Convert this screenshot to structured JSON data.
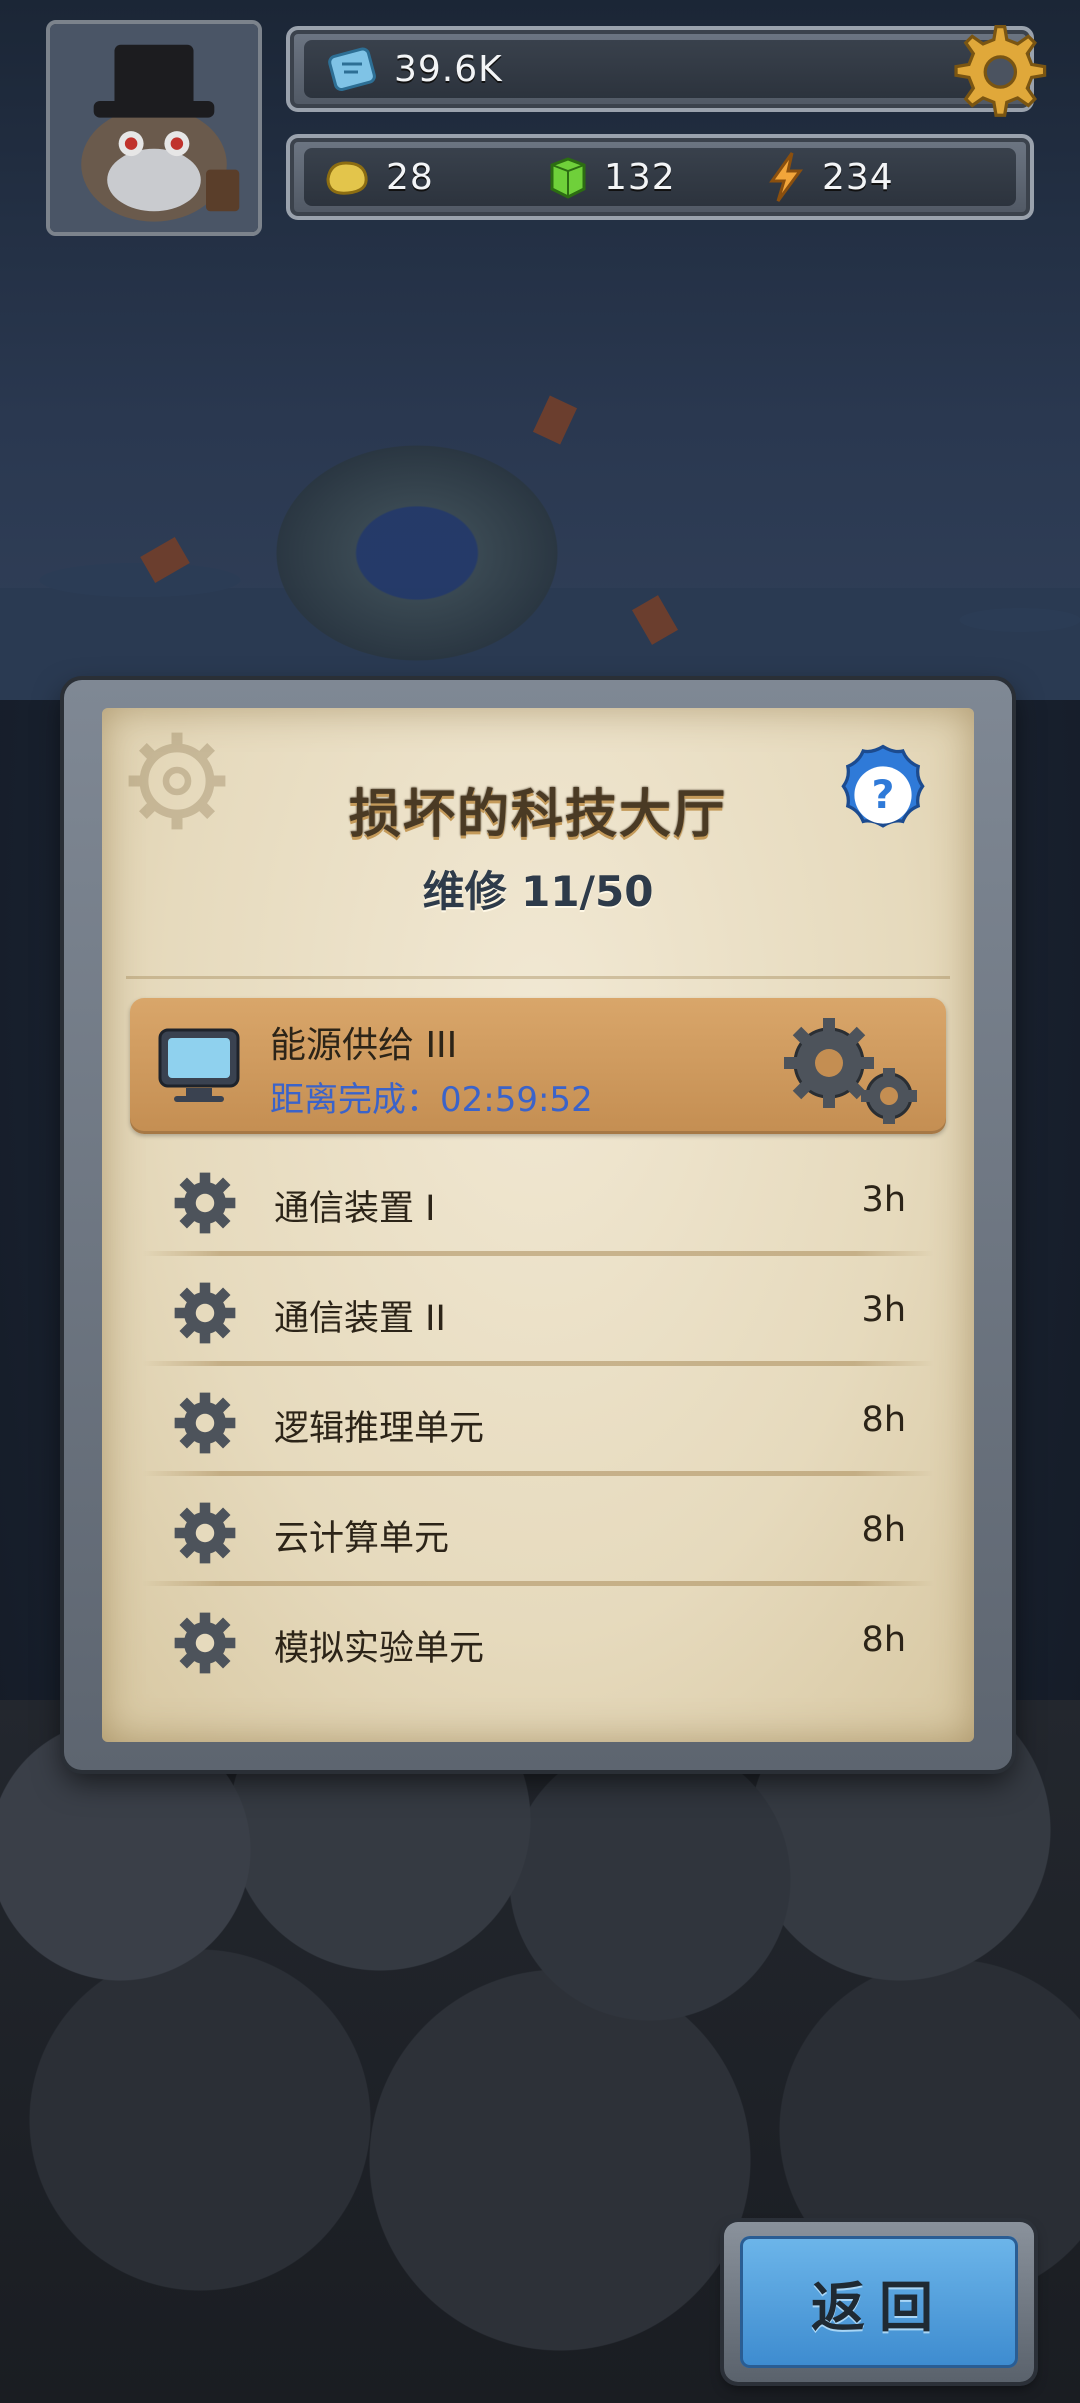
{
  "hud": {
    "crystals": "39.6K",
    "gold": "28",
    "gems": "132",
    "energy": "234"
  },
  "panel": {
    "title": "损坏的科技大厅",
    "progress": "维修 11/50",
    "active_task": {
      "name": "能源供给 III",
      "timer": "距离完成：02:59:52"
    },
    "tasks": [
      {
        "name": "通信装置 I",
        "time": "3h"
      },
      {
        "name": "通信装置 II",
        "time": "3h"
      },
      {
        "name": "逻辑推理单元",
        "time": "8h"
      },
      {
        "name": "云计算单元",
        "time": "8h"
      },
      {
        "name": "模拟实验单元",
        "time": "8h"
      }
    ]
  },
  "back_button": {
    "label": "返回"
  },
  "colors": {
    "accent_orange": "#c48e52",
    "timer_blue": "#3b63c9",
    "button_blue": "#3d8bcf",
    "help_blue": "#2f7ad8"
  },
  "icons": [
    "crystal-icon",
    "gold-icon",
    "gem-icon",
    "energy-icon",
    "gear-icon",
    "help-icon",
    "monitor-icon"
  ]
}
